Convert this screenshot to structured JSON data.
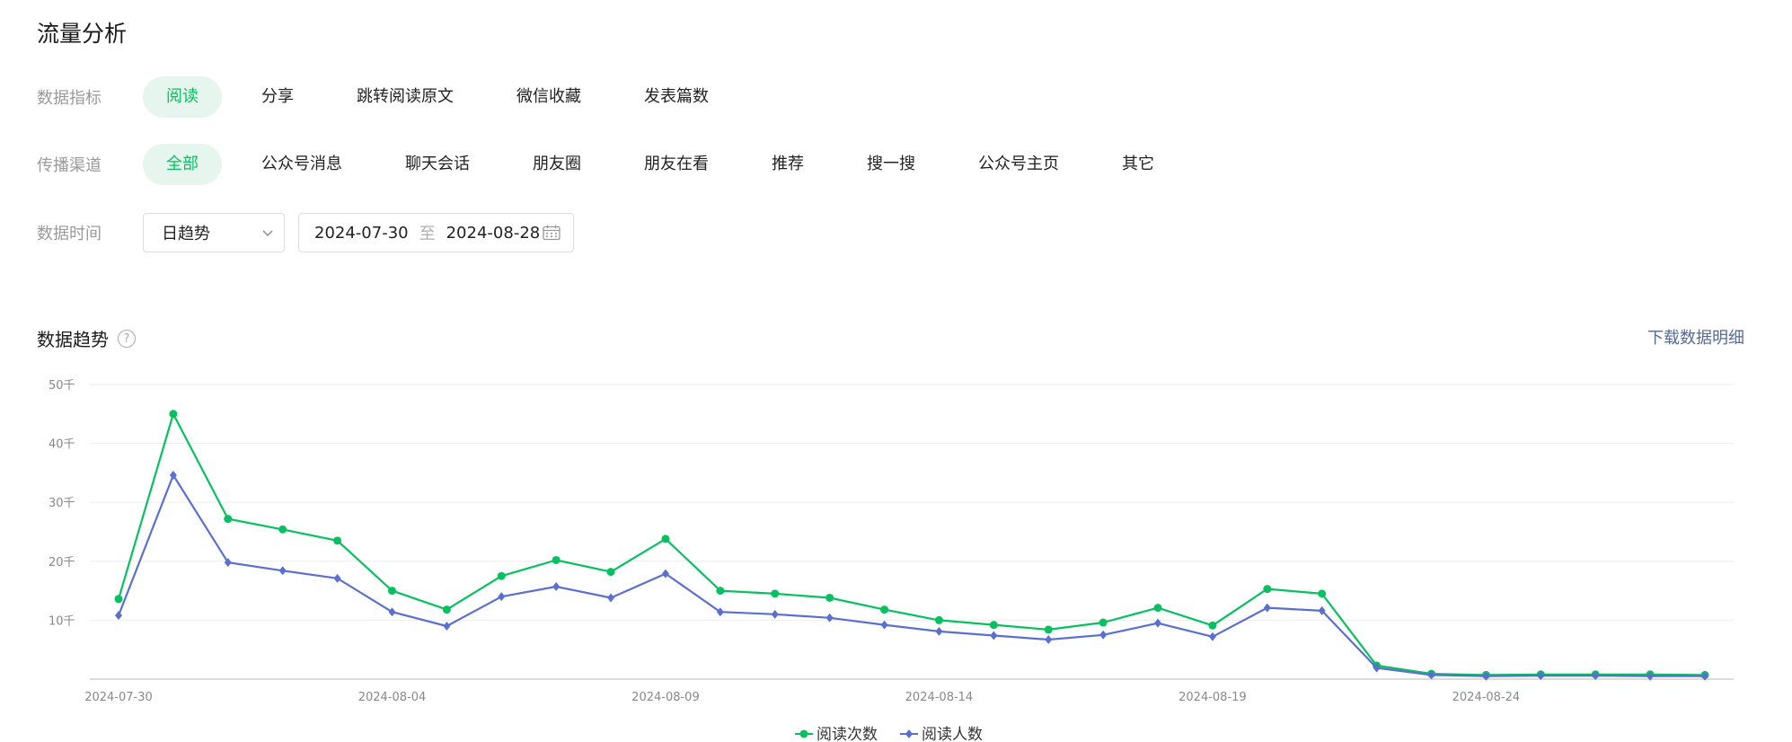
{
  "page_title": "流量分析",
  "metric_filter": {
    "label": "数据指标",
    "options": [
      "阅读",
      "分享",
      "跳转阅读原文",
      "微信收藏",
      "发表篇数"
    ],
    "active": 0
  },
  "channel_filter": {
    "label": "传播渠道",
    "options": [
      "全部",
      "公众号消息",
      "聊天会话",
      "朋友圈",
      "朋友在看",
      "推荐",
      "搜一搜",
      "公众号主页",
      "其它"
    ],
    "active": 0
  },
  "time_filter": {
    "label": "数据时间",
    "granularity": "日趋势",
    "start_date": "2024-07-30",
    "separator": "至",
    "end_date": "2024-08-28"
  },
  "trend": {
    "title": "数据趋势",
    "help": "?",
    "download_label": "下载数据明细"
  },
  "colors": {
    "accent": "#07c160",
    "accent_bg": "#e6f5ee",
    "series_reads": "#07c160",
    "series_readers": "#5b6fd0",
    "link": "#576b95"
  },
  "icons": [
    "chevron-down-icon",
    "calendar-icon",
    "help-circle-icon"
  ],
  "chart_data": {
    "type": "line",
    "x": [
      "2024-07-30",
      "2024-07-31",
      "2024-08-01",
      "2024-08-02",
      "2024-08-03",
      "2024-08-04",
      "2024-08-05",
      "2024-08-06",
      "2024-08-07",
      "2024-08-08",
      "2024-08-09",
      "2024-08-10",
      "2024-08-11",
      "2024-08-12",
      "2024-08-13",
      "2024-08-14",
      "2024-08-15",
      "2024-08-16",
      "2024-08-17",
      "2024-08-18",
      "2024-08-19",
      "2024-08-20",
      "2024-08-21",
      "2024-08-22",
      "2024-08-23",
      "2024-08-24",
      "2024-08-25",
      "2024-08-26",
      "2024-08-27",
      "2024-08-28"
    ],
    "x_tick_labels": [
      "2024-07-30",
      "2024-08-04",
      "2024-08-09",
      "2024-08-14",
      "2024-08-19",
      "2024-08-24"
    ],
    "x_tick_index": [
      0,
      5,
      10,
      15,
      20,
      25
    ],
    "y_ticks": [
      10000,
      20000,
      30000,
      40000,
      50000
    ],
    "y_tick_labels": [
      "10千",
      "20千",
      "30千",
      "40千",
      "50千"
    ],
    "ylim": [
      0,
      50000
    ],
    "grid": true,
    "legend_position": "bottom-center",
    "series": [
      {
        "name": "阅读次数",
        "color": "#07c160",
        "marker": "circle",
        "values": [
          13600,
          45000,
          27200,
          25400,
          23500,
          15000,
          11800,
          17500,
          20200,
          18200,
          23800,
          15000,
          14500,
          13800,
          11800,
          10000,
          9200,
          8400,
          9600,
          12100,
          9100,
          15300,
          14500,
          2300,
          900,
          700,
          800,
          800,
          800,
          700
        ]
      },
      {
        "name": "阅读人数",
        "color": "#5b6fd0",
        "marker": "diamond",
        "values": [
          10800,
          34600,
          19800,
          18400,
          17100,
          11400,
          9000,
          14000,
          15700,
          13800,
          17900,
          11400,
          11000,
          10400,
          9200,
          8100,
          7400,
          6700,
          7500,
          9500,
          7200,
          12100,
          11600,
          1900,
          700,
          500,
          600,
          600,
          500,
          500
        ]
      }
    ]
  }
}
